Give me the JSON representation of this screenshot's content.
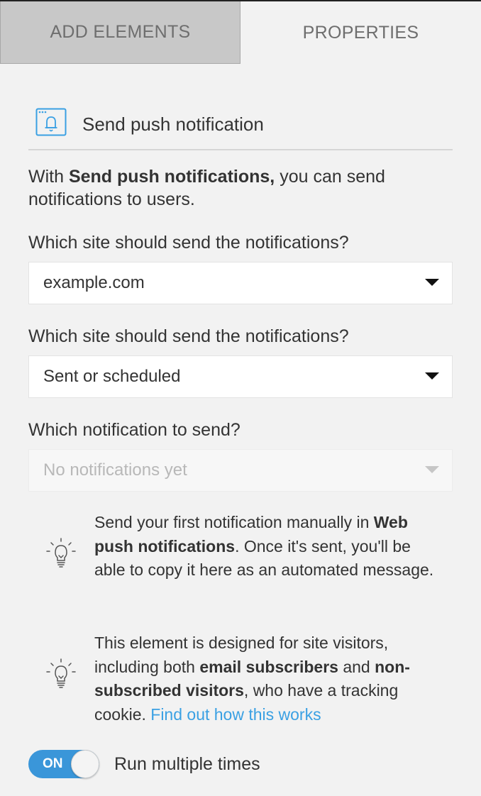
{
  "tabs": {
    "add_elements": "ADD ELEMENTS",
    "properties": "PROPERTIES"
  },
  "header": {
    "icon": "browser-bell-icon",
    "title": "Send push notification"
  },
  "intro": {
    "prefix": "With ",
    "bold": "Send push notifications,",
    "suffix": " you can send notifications to users."
  },
  "fields": {
    "site_label": "Which site should send the notifications?",
    "site_value": "example.com",
    "status_label": "Which site should send the notifications?",
    "status_value": "Sent or scheduled",
    "notification_label": "Which notification to send?",
    "notification_placeholder": "No notifications yet"
  },
  "tips": {
    "tip1": {
      "icon": "lightbulb-icon",
      "part1": "Send your first notification manually in ",
      "bold1": "Web push notifications",
      "part2": ". Once it's sent, you'll be able to copy it here as an automated message."
    },
    "tip2": {
      "icon": "lightbulb-icon",
      "part1": "This element is designed for site visitors, including both ",
      "bold1": "email subscribers",
      "part2": " and ",
      "bold2": "non-subscribed visitors",
      "part3": ", who have a tracking cookie. ",
      "link": "Find out how this works"
    }
  },
  "toggle": {
    "state": "ON",
    "label": "Run multiple times"
  },
  "colors": {
    "accent": "#3a96d9",
    "link": "#3aa0e3",
    "icon_blue": "#3aa0e3"
  }
}
